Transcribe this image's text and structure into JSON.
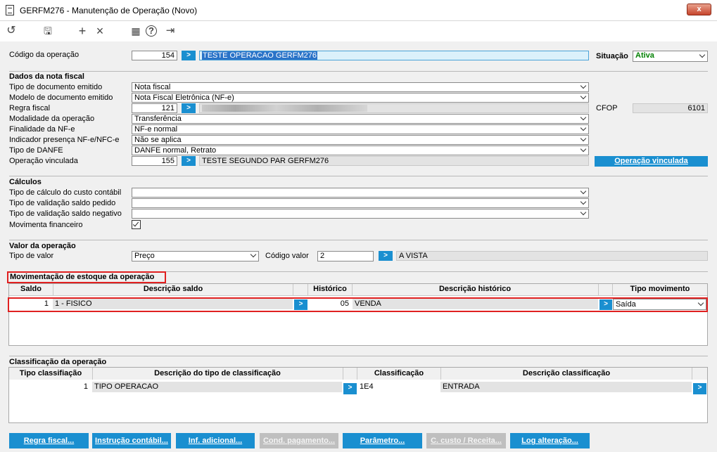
{
  "window": {
    "title": "GERFM276 - Manutenção de Operação (Novo)",
    "close": "x"
  },
  "toolbar": {
    "undo": "↺",
    "save": "🖫",
    "add": "+",
    "delete": "×",
    "calendar": "▦",
    "help": "?",
    "exit": "⇥"
  },
  "header": {
    "codigo_label": "Código da operação",
    "codigo_value": "154",
    "descricao_value": "TESTE OPERACAO GERFM276",
    "situacao_label": "Situação",
    "situacao_value": "Ativa"
  },
  "nota_fiscal": {
    "section": "Dados da nota fiscal",
    "tipo_doc_label": "Tipo de documento emitido",
    "tipo_doc_value": "Nota fiscal",
    "modelo_label": "Modelo de documento emitido",
    "modelo_value": "Nota Fiscal Eletrônica (NF-e)",
    "regra_label": "Regra fiscal",
    "regra_value": "121",
    "cfop_label": "CFOP",
    "cfop_value": "6101",
    "modalidade_label": "Modalidade da operação",
    "modalidade_value": "Transferência",
    "finalidade_label": "Finalidade da NF-e",
    "finalidade_value": "NF-e normal",
    "indicador_label": "Indicador presença NF-e/NFC-e",
    "indicador_value": "Não se aplica",
    "danfe_label": "Tipo de DANFE",
    "danfe_value": "DANFE normal, Retrato",
    "vinculada_label": "Operação vinculada",
    "vinculada_code": "155",
    "vinculada_desc": "TESTE SEGUNDO PAR GERFM276",
    "vinculada_button": "Operação vinculada"
  },
  "calculos": {
    "section": "Cálculos",
    "custo_label": "Tipo de cálculo do custo contábil",
    "saldo_pedido_label": "Tipo de validação saldo pedido",
    "saldo_negativo_label": "Tipo de validação saldo negativo",
    "financeiro_label": "Movimenta financeiro"
  },
  "valor": {
    "section": "Valor da operação",
    "tipo_label": "Tipo de valor",
    "tipo_value": "Preço",
    "codigo_label": "Código valor",
    "codigo_value": "2",
    "codigo_desc": "A VISTA"
  },
  "estoque": {
    "section": "Movimentação de estoque da operação",
    "headers": [
      "Saldo",
      "Descrição saldo",
      "Histórico",
      "Descrição histórico",
      "Tipo movimento"
    ],
    "row": {
      "saldo": "1",
      "desc_saldo": "1 - FISICO",
      "historico": "05",
      "desc_historico": "VENDA",
      "tipo": "Saída"
    }
  },
  "classificacao": {
    "section": "Classificação da operação",
    "headers": [
      "Tipo classifiação",
      "Descrição do tipo de classificação",
      "Classificação",
      "Descrição classificação"
    ],
    "row": {
      "tipo": "1",
      "desc_tipo": "TIPO OPERACAO",
      "classif": "1E4",
      "desc_classif": "ENTRADA"
    }
  },
  "buttons": [
    "Regra fiscal...",
    "Instrução contábil...",
    "Inf. adicional...",
    "Cond. pagamento...",
    "Parâmetro...",
    "C. custo / Receita...",
    "Log alteração..."
  ],
  "arrow": ">",
  "colors": {
    "accent": "#1a8fd0",
    "situacao": "#008000",
    "highlight": "#e02020"
  }
}
